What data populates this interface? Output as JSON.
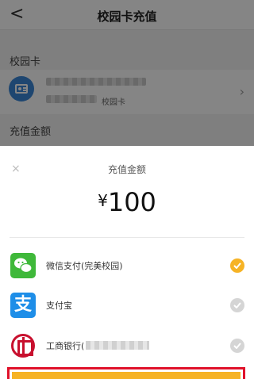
{
  "nav": {
    "title": "校园卡充值",
    "back_glyph": "<"
  },
  "campus_card": {
    "section_label": "校园卡",
    "type_label": "校园卡"
  },
  "amount_section": {
    "label": "充值金额"
  },
  "sheet": {
    "close_glyph": "×",
    "title": "充值金额",
    "amount": {
      "currency": "¥",
      "value": "100"
    },
    "payment_methods": [
      {
        "label": "微信支付(完美校园)",
        "icon": "wechat-icon",
        "selected": true
      },
      {
        "label": "支付宝",
        "icon": "alipay-icon",
        "selected": false
      },
      {
        "label": "工商银行(",
        "icon": "icbc-icon",
        "selected": false
      }
    ]
  },
  "colors": {
    "accent": "#f6b325",
    "highlight_border": "#e0122a",
    "card_icon": "#3a86d6",
    "wechat": "#3fb83a",
    "alipay": "#1e8ee8",
    "icbc": "#c8102e"
  }
}
